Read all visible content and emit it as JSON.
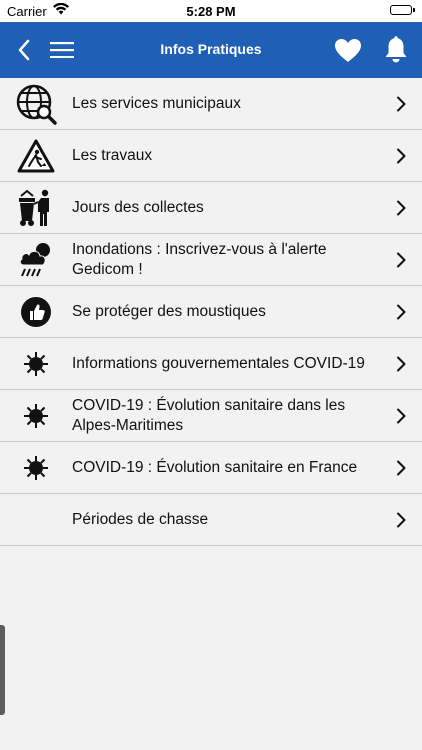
{
  "status_bar": {
    "carrier": "Carrier",
    "time": "5:28 PM"
  },
  "navbar": {
    "title": "Infos Pratiques",
    "color": "#1f5fb5"
  },
  "items": [
    {
      "label": "Les services municipaux",
      "icon": "globe-search-icon"
    },
    {
      "label": "Les travaux",
      "icon": "roadwork-sign-icon"
    },
    {
      "label": "Jours des collectes",
      "icon": "waste-collection-icon"
    },
    {
      "label": "Inondations : Inscrivez-vous à l'alerte Gedicom !",
      "icon": "rain-cloud-icon"
    },
    {
      "label": "Se protéger des moustiques",
      "icon": "thumbs-up-icon"
    },
    {
      "label": "Informations gouvernementales COVID-19",
      "icon": "virus-icon"
    },
    {
      "label": "COVID-19 : Évolution sanitaire dans les Alpes-Maritimes",
      "icon": "virus-icon"
    },
    {
      "label": "COVID-19 : Évolution sanitaire en France",
      "icon": "virus-icon"
    },
    {
      "label": "Périodes de chasse",
      "icon": ""
    }
  ]
}
